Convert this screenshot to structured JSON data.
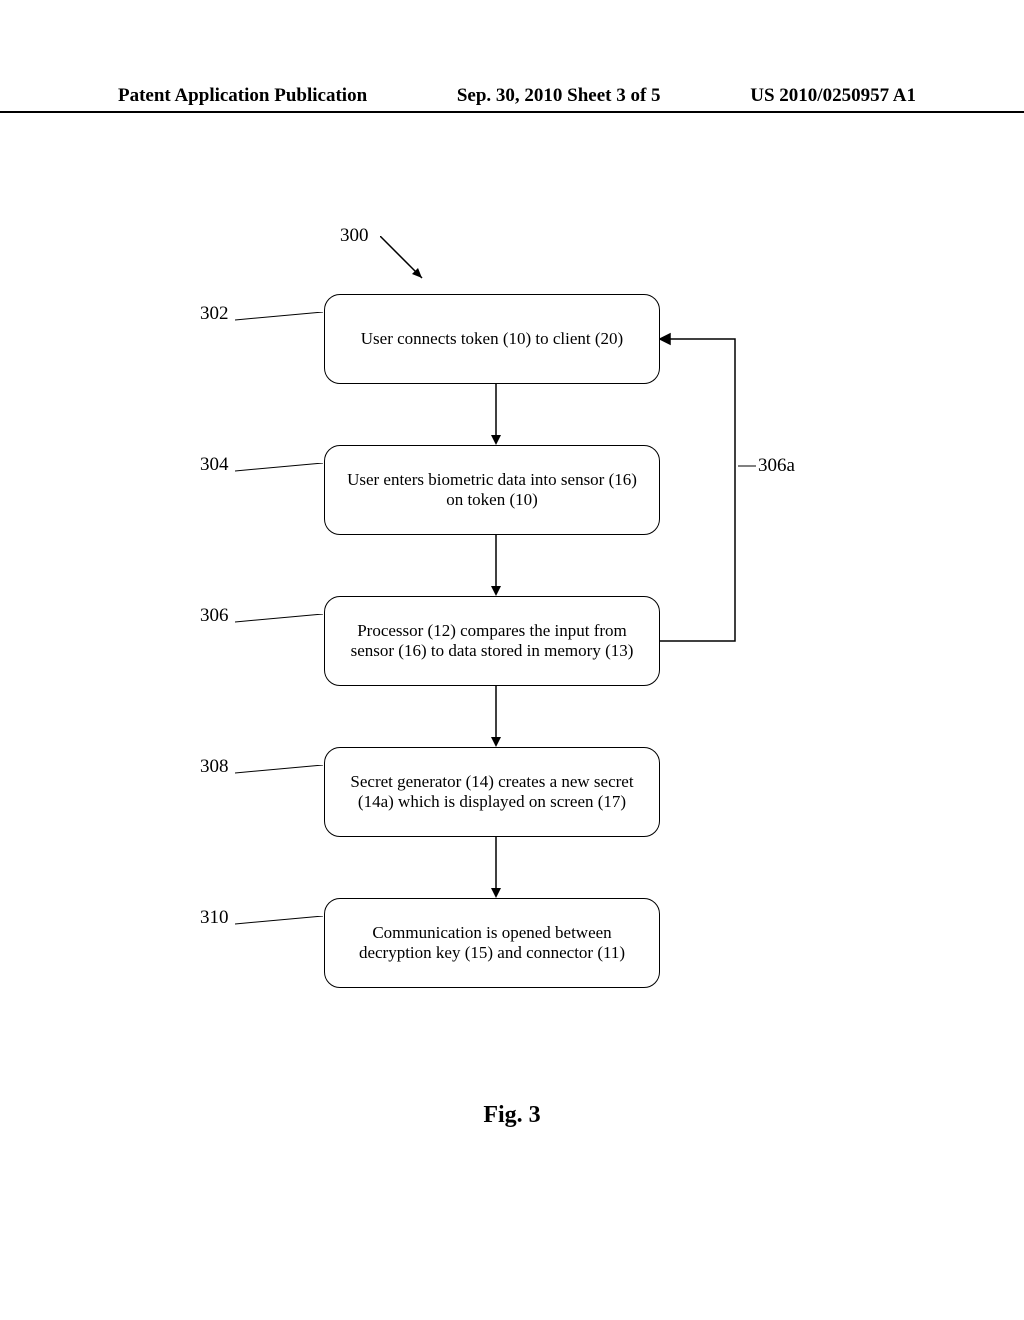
{
  "header": {
    "left": "Patent Application Publication",
    "center": "Sep. 30, 2010  Sheet 3 of 5",
    "right": "US 2010/0250957 A1"
  },
  "refs": {
    "r300": "300",
    "r302": "302",
    "r304": "304",
    "r306": "306",
    "r306a": "306a",
    "r308": "308",
    "r310": "310"
  },
  "boxes": {
    "b302": "User connects token (10) to client (20)",
    "b304": "User enters biometric data into sensor (16) on token (10)",
    "b306": "Processor (12) compares the input from sensor (16) to data stored in memory (13)",
    "b308": "Secret generator (14) creates a new secret (14a) which is displayed on screen (17)",
    "b310": "Communication is opened between decryption key (15) and connector (11)"
  },
  "figure": "Fig. 3",
  "chart_data": {
    "type": "flowchart",
    "title": "Fig. 3",
    "overall_ref": "300",
    "nodes": [
      {
        "id": "302",
        "label": "User connects token (10) to client (20)"
      },
      {
        "id": "304",
        "label": "User enters biometric data into sensor (16) on token (10)"
      },
      {
        "id": "306",
        "label": "Processor (12) compares the input from sensor (16) to data stored in memory (13)"
      },
      {
        "id": "308",
        "label": "Secret generator (14) creates a new secret (14a) which is displayed on screen (17)"
      },
      {
        "id": "310",
        "label": "Communication is opened between decryption key (15) and connector (11)"
      }
    ],
    "edges": [
      {
        "from": "302",
        "to": "304"
      },
      {
        "from": "304",
        "to": "306"
      },
      {
        "from": "306",
        "to": "308"
      },
      {
        "from": "308",
        "to": "310"
      },
      {
        "from": "306",
        "to": "302",
        "label": "306a",
        "feedback": true
      }
    ]
  }
}
